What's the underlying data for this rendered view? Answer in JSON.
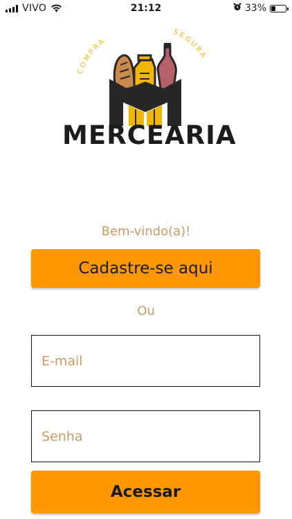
{
  "status_bar": {
    "carrier": "VIVO",
    "time": "21:12",
    "battery_percent": "33%",
    "battery_level": 0.33
  },
  "logo": {
    "arc_text_left": "COMPRA",
    "arc_text_right": "SEGURA",
    "wordmark": "MERCEARIA",
    "colors": {
      "dark": "#262626",
      "yellow": "#f2b705",
      "bread": "#c98a4b",
      "wine": "#b5616a"
    }
  },
  "main": {
    "welcome_text": "Bem-vindo(a)!",
    "register_button_label": "Cadastre-se aqui",
    "or_text": "Ou",
    "email_placeholder": "E-mail",
    "password_placeholder": "Senha",
    "login_button_label": "Acessar"
  },
  "colors": {
    "accent": "#ff9800",
    "muted_text": "#c99b63"
  }
}
